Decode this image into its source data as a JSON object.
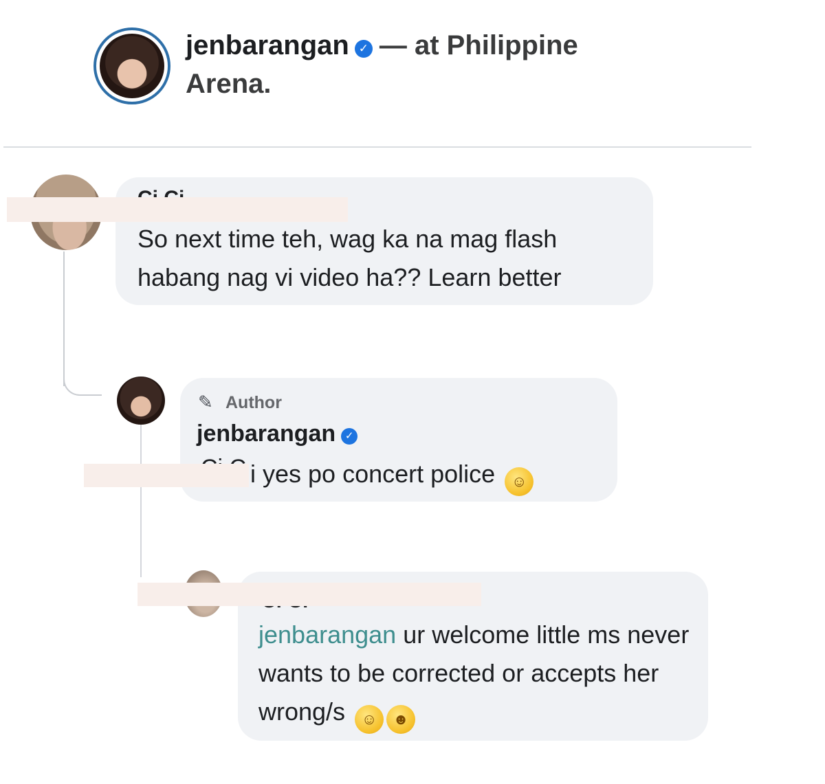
{
  "post": {
    "username": "jenbarangan",
    "location_prefix": "— at Philippine",
    "location_rest": "Arena."
  },
  "comments": [
    {
      "name_fragment": "Ci Ci",
      "text": "So next time teh, wag ka na mag flash habang nag vi video ha?? Learn better"
    },
    {
      "author_tag": "Author",
      "username": "jenbarangan",
      "mention_fragment": "Ci C",
      "text": "i yes po concert police",
      "emoji": "☺"
    },
    {
      "name_fragment": "Ci Ci",
      "mention": "jenbarangan",
      "text": " ur welcome little ms never wants to be corrected or accepts her wrong/s",
      "emojis": [
        "☺",
        "☻"
      ]
    }
  ],
  "icons": {
    "verified": "verified-badge-icon",
    "pencil": "pencil-icon"
  },
  "colors": {
    "bubble": "#f0f2f5",
    "verified": "#1d74e0",
    "mention": "#3e8e8e",
    "avatar_ring": "#2e6fa8",
    "redaction": "#f8eeea"
  }
}
